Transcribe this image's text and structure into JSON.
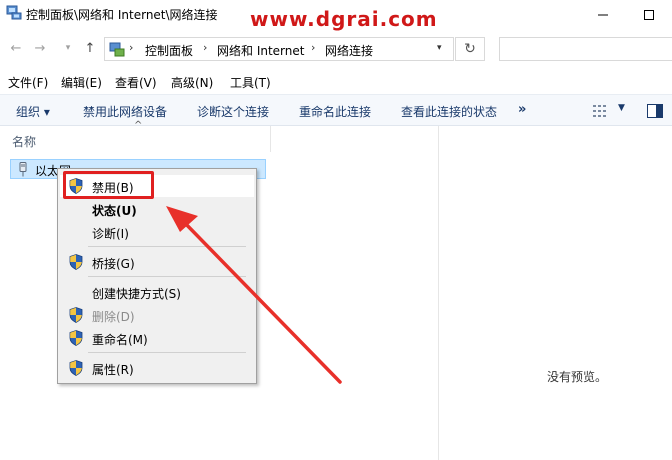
{
  "window": {
    "title": "控制面板\\网络和 Internet\\网络连接",
    "watermark": "www.dgrai.com"
  },
  "address": {
    "breadcrumbs": [
      "控制面板",
      "网络和 Internet",
      "网络连接"
    ]
  },
  "menubar": {
    "items": [
      "文件(F)",
      "编辑(E)",
      "查看(V)",
      "高级(N)",
      "工具(T)"
    ]
  },
  "commandbar": {
    "organize": "组织 ▾",
    "items": [
      "禁用此网络设备",
      "诊断这个连接",
      "重命名此连接",
      "查看此连接的状态"
    ],
    "more": "»"
  },
  "list": {
    "column_header": "名称",
    "items": [
      {
        "label": "以太网"
      }
    ]
  },
  "context_menu": {
    "items": [
      {
        "label": "禁用(B)",
        "shield": true
      },
      {
        "label": "状态(U)",
        "shield": false,
        "bold": true
      },
      {
        "label": "诊断(I)",
        "shield": false
      },
      {
        "label": "桥接(G)",
        "shield": true
      },
      {
        "label": "创建快捷方式(S)",
        "shield": false
      },
      {
        "label": "删除(D)",
        "shield": true,
        "disabled": true
      },
      {
        "label": "重命名(M)",
        "shield": true
      },
      {
        "label": "属性(R)",
        "shield": true
      }
    ]
  },
  "preview": {
    "empty_text": "没有预览。"
  },
  "colors": {
    "accent_selection": "#cce8ff",
    "annotation_red": "#e02020",
    "command_text": "#1a3a6b"
  }
}
